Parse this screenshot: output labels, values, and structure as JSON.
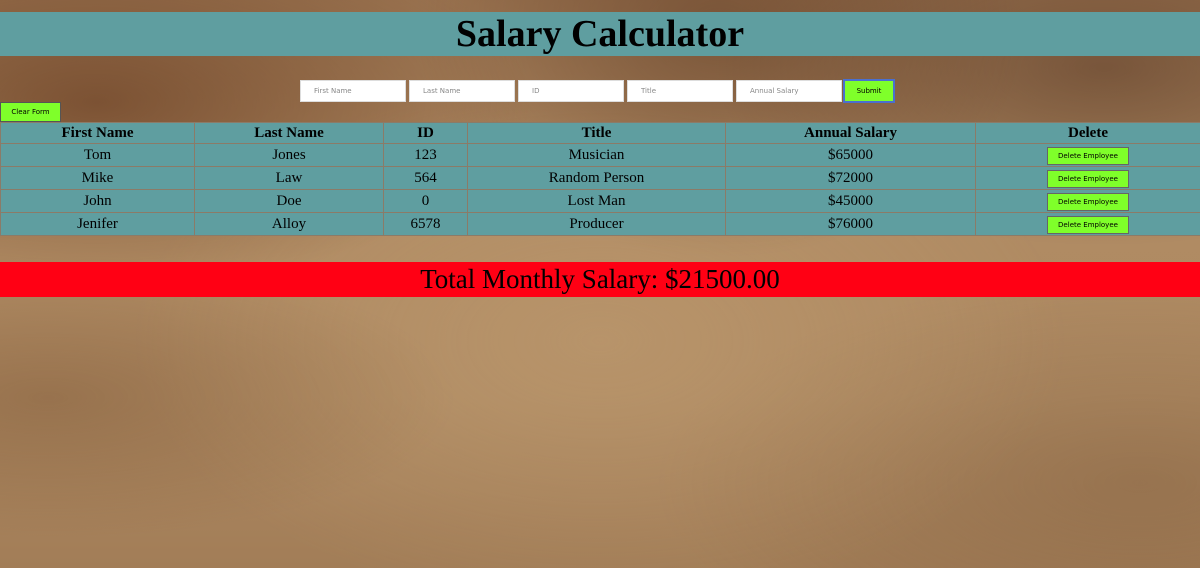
{
  "header": {
    "title": "Salary Calculator"
  },
  "form": {
    "first_name_placeholder": "First Name",
    "last_name_placeholder": "Last Name",
    "id_placeholder": "ID",
    "title_placeholder": "Title",
    "annual_salary_placeholder": "Annual Salary",
    "submit_label": "Submit",
    "clear_label": "Clear Form"
  },
  "table": {
    "columns": [
      "First Name",
      "Last Name",
      "ID",
      "Title",
      "Annual Salary",
      "Delete"
    ],
    "rows": [
      {
        "first": "Tom",
        "last": "Jones",
        "id": "123",
        "title": "Musician",
        "salary": "$65000",
        "delete_label": "Delete Employee"
      },
      {
        "first": "Mike",
        "last": "Law",
        "id": "564",
        "title": "Random Person",
        "salary": "$72000",
        "delete_label": "Delete Employee"
      },
      {
        "first": "John",
        "last": "Doe",
        "id": "0",
        "title": "Lost Man",
        "salary": "$45000",
        "delete_label": "Delete Employee"
      },
      {
        "first": "Jenifer",
        "last": "Alloy",
        "id": "6578",
        "title": "Producer",
        "salary": "$76000",
        "delete_label": "Delete Employee"
      }
    ]
  },
  "total": {
    "text": "Total Monthly Salary: $21500.00"
  },
  "colors": {
    "header_bg": "#5f9ea0",
    "button_green": "#7fff2a",
    "total_bg": "#ff0014",
    "submit_border": "#4a6fd0"
  }
}
